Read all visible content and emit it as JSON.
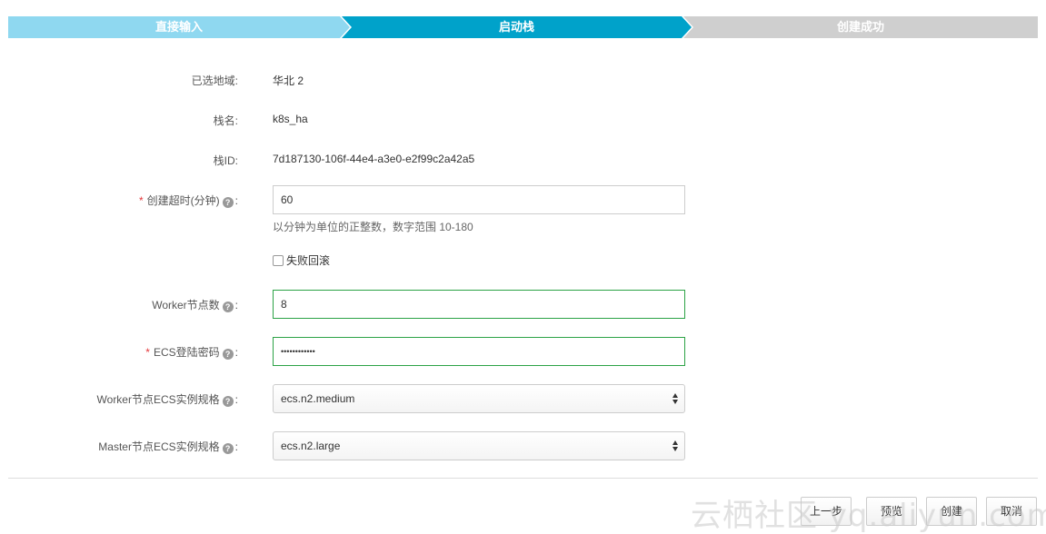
{
  "steps": [
    {
      "label": "直接输入",
      "state": "done",
      "color": "#8fd8f0"
    },
    {
      "label": "启动栈",
      "state": "active",
      "color": "#00a2ca"
    },
    {
      "label": "创建成功",
      "state": "pending",
      "color": "#cfcfcf"
    }
  ],
  "fields": {
    "region": {
      "label": "已选地域:",
      "value": "华北 2"
    },
    "stack_name": {
      "label": "栈名:",
      "value": "k8s_ha"
    },
    "stack_id": {
      "label": "栈ID:",
      "value": "7d187130-106f-44e4-a3e0-e2f99c2a42a5"
    },
    "timeout": {
      "required_mark": "*",
      "label": "创建超时(分钟)",
      "colon": ":",
      "value": "60",
      "hint": "以分钟为单位的正整数，数字范围 10-180"
    },
    "rollback": {
      "label": "失败回滚",
      "checked": false
    },
    "worker_count": {
      "label": "Worker节点数",
      "colon": ":",
      "value": "8"
    },
    "ecs_password": {
      "required_mark": "*",
      "label": "ECS登陆密码",
      "colon": ":",
      "value": "••••••••••••"
    },
    "worker_instance_type": {
      "label": "Worker节点ECS实例规格",
      "colon": ":",
      "selected": "ecs.n2.medium"
    },
    "master_instance_type": {
      "label": "Master节点ECS实例规格",
      "colon": ":",
      "selected": "ecs.n2.large"
    }
  },
  "help_icon_glyph": "?",
  "buttons": {
    "prev": "上一步",
    "preview": "预览",
    "create": "创建",
    "cancel": "取消"
  },
  "watermark": "云栖社区 yq.aliyun.com",
  "colors": {
    "required": "#e4393c",
    "valid_border": "#2ba245",
    "help_icon": "#999999"
  }
}
